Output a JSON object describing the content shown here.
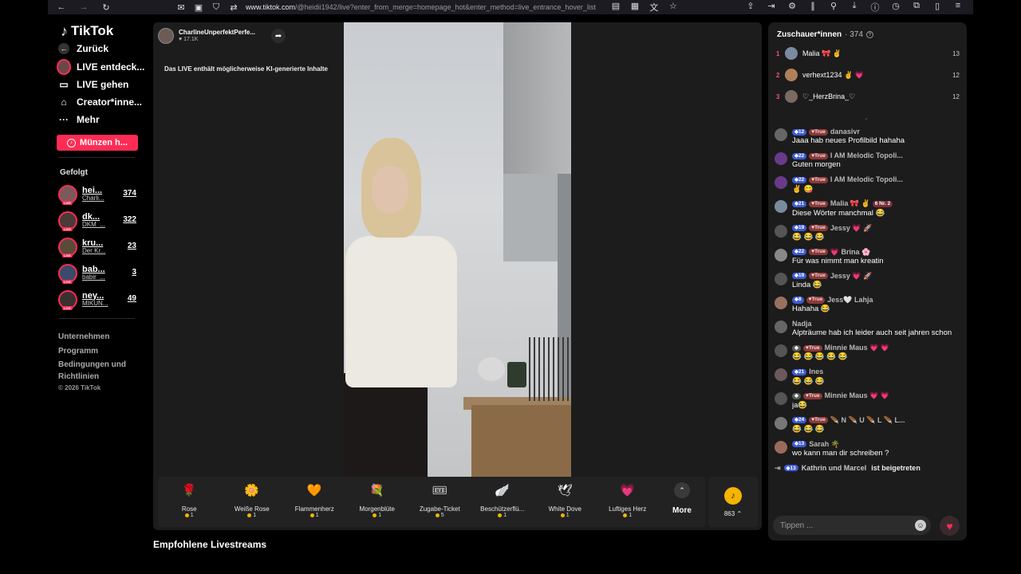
{
  "browser": {
    "url_host": "www.tiktok.com",
    "url_path": "/@heidii1942/live?enter_from_merge=homepage_hot&enter_method=live_entrance_hover_list"
  },
  "sidebar": {
    "logo": "TikTok",
    "back": "Zurück",
    "nav": [
      {
        "label": "LIVE entdeck...",
        "icon": "live-avatar-icon"
      },
      {
        "label": "LIVE gehen",
        "icon": "video-camera-icon"
      },
      {
        "label": "Creator*inne...",
        "icon": "home-icon"
      },
      {
        "label": "Mehr",
        "icon": "more-dots-icon"
      }
    ],
    "coins_button": "Münzen h...",
    "followed_heading": "Gefolgt",
    "followed": [
      {
        "name": "hei...",
        "sub": "Charli...",
        "count": "374",
        "color": "#7a5a5a"
      },
      {
        "name": "dk...",
        "sub": "DKM_...",
        "count": "322",
        "color": "#4a3a3a"
      },
      {
        "name": "kru...",
        "sub": "Der Kr...",
        "count": "23",
        "color": "#5a4a3a"
      },
      {
        "name": "bab...",
        "sub": "babir_...",
        "count": "3",
        "color": "#3a4a6a"
      },
      {
        "name": "ney...",
        "sub": "MIKUN...",
        "count": "49",
        "color": "#3a3030"
      }
    ],
    "footer": [
      "Unternehmen",
      "Programm",
      "Bedingungen und",
      "Richtlinien"
    ],
    "copyright": "© 2026 TikTok"
  },
  "stage": {
    "host_name": "CharlineUnperfektPerfe...",
    "host_likes": "17.1K",
    "ai_notice": "Das LIVE enthält möglicherweise KI-generierte Inhalte",
    "gifts": [
      {
        "name": "Rose",
        "price": "1",
        "icon": "🌹"
      },
      {
        "name": "Weiße Rose",
        "price": "1",
        "icon": "🌼"
      },
      {
        "name": "Flammenherz",
        "price": "1",
        "icon": "🧡"
      },
      {
        "name": "Morgenblüte",
        "price": "1",
        "icon": "💐"
      },
      {
        "name": "Zugabe-Ticket",
        "price": "5",
        "icon": "🎟"
      },
      {
        "name": "Beschützerflü...",
        "price": "1",
        "icon": "🪽"
      },
      {
        "name": "White Dove",
        "price": "1",
        "icon": "🕊"
      },
      {
        "name": "Luftiges Herz",
        "price": "1",
        "icon": "💗"
      }
    ],
    "more_label": "More",
    "coin_balance": "863",
    "recommended": "Empfohlene Livestreams"
  },
  "panel": {
    "viewers_label": "Zuschauer*innen",
    "viewers_count": "· 374",
    "ranking": [
      {
        "rank": "1",
        "name": "Malia 🎀 ✌",
        "score": "13",
        "color": "#7a8aa0"
      },
      {
        "rank": "2",
        "name": "verhext1234 ✌ 💗",
        "score": "12",
        "color": "#b0805a"
      },
      {
        "rank": "3",
        "name": "♡_HerzBrina_♡",
        "score": "12",
        "color": "#7a6a60"
      }
    ],
    "messages": [
      {
        "lvl": "12",
        "fan": "True",
        "user": "danasivr",
        "text": "Jaaa hab neues Profilbild hahaha",
        "color": "#666"
      },
      {
        "lvl": "22",
        "fan": "True",
        "user": "I AM Melodic Topoli...",
        "text": "Guten morgen",
        "color": "#6a3a8a"
      },
      {
        "lvl": "22",
        "fan": "True",
        "user": "I AM Melodic Topoli...",
        "text": "✌ 😋",
        "color": "#6a3a8a"
      },
      {
        "lvl": "21",
        "fan": "True",
        "user": "Malia 🎀 ✌",
        "nr": "6 Nr. 2",
        "text": "Diese Wörter manchmal 😂",
        "color": "#7a8aa0"
      },
      {
        "lvl": "19",
        "fan": "True",
        "user": "Jessy 💗 🚀",
        "text": "😂 😂 😂",
        "color": "#555"
      },
      {
        "lvl": "22",
        "fan": "True",
        "user": "💗 Brina 🌸",
        "text": "Für was nimmt man kreatin",
        "color": "#888"
      },
      {
        "lvl": "19",
        "fan": "True",
        "user": "Jessy 💗 🚀",
        "text": "Linda 😂",
        "color": "#555"
      },
      {
        "lvl": "8",
        "fan": "True",
        "user": "Jess🤍 Lahja",
        "text": "Hahaha 😂",
        "color": "#9a7060"
      },
      {
        "lvl": "",
        "fan": "",
        "user": "Nadja",
        "text": "Alpträume hab ich leider auch seit jahren schon",
        "color": "#666"
      },
      {
        "lvl": "",
        "fan": "True",
        "grey": true,
        "user": "Minnie Maus 💗 💗",
        "text": "😂 😂 😂 😂 😂",
        "color": "#555"
      },
      {
        "lvl": "21",
        "fan": "",
        "user": "Ines",
        "text": "😂 😂 😂",
        "color": "#6a5a5a"
      },
      {
        "lvl": "",
        "fan": "True",
        "grey": true,
        "user": "Minnie Maus 💗 💗",
        "text": "ja😂",
        "color": "#555"
      },
      {
        "lvl": "24",
        "fan": "True",
        "user": "🪶 N 🪶 U 🪶 L 🪶 L...",
        "text": "😂 😂 😂",
        "color": "#777"
      },
      {
        "lvl": "13",
        "fan": "",
        "user": "Sarah 🌴",
        "text": "wo kann man dir schreiben ?",
        "color": "#9a6a5a"
      }
    ],
    "joined_lvl": "13",
    "joined_user": "Kathrin und Marcel",
    "joined_text": "ist beigetreten",
    "input_placeholder": "Tippen ..."
  }
}
